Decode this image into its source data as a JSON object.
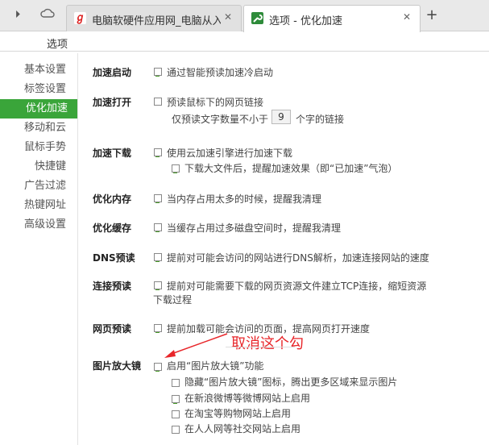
{
  "tabs": [
    {
      "title": "电脑软硬件应用网_电脑从入门",
      "icon": "site-logo-icon",
      "active": false
    },
    {
      "title": "选项 - 优化加速",
      "icon": "wrench-icon",
      "active": true
    }
  ],
  "page_title": "选项",
  "sidebar": {
    "items": [
      {
        "label": "基本设置"
      },
      {
        "label": "标签设置"
      },
      {
        "label": "优化加速",
        "active": true
      },
      {
        "label": "移动和云"
      },
      {
        "label": "鼠标手势"
      },
      {
        "label": "快捷键"
      },
      {
        "label": "广告过滤"
      },
      {
        "label": "热键网址"
      },
      {
        "label": "高级设置"
      }
    ]
  },
  "sections": {
    "startup": {
      "label": "加速启动",
      "option": "通过智能预读加速冷启动"
    },
    "open": {
      "label": "加速打开",
      "option1": "预读鼠标下的网页链接",
      "min_prefix": "仅预读文字数量不小于",
      "min_value": "9",
      "min_suffix": "个字的链接"
    },
    "download": {
      "label": "加速下载",
      "option1": "使用云加速引擎进行加速下载",
      "option2": "下载大文件后，提醒加速效果（即“已加速”气泡）"
    },
    "memory": {
      "label": "优化内存",
      "option": "当内存占用太多的时候，提醒我清理"
    },
    "cache": {
      "label": "优化缓存",
      "option": "当缓存占用过多磁盘空间时，提醒我清理"
    },
    "dns": {
      "label": "DNS预读",
      "option": "提前对可能会访问的网站进行DNS解析，加速连接网站的速度"
    },
    "preconnect": {
      "label": "连接预读",
      "option_line1": "提前对可能需要下载的网页资源文件建立TCP连接，缩短资源",
      "option_line2": "下载过程"
    },
    "prefetch": {
      "label": "网页预读",
      "option": "提前加载可能会访问的页面，提高网页打开速度"
    },
    "magnifier": {
      "label": "图片放大镜",
      "option": "启用“图片放大镜”功能",
      "sub": [
        "隐藏“图片放大镜”图标，腾出更多区域来显示图片",
        "在新浪微博等微博网站上启用",
        "在淘宝等购物网站上启用",
        "在人人网等社交网站上启用"
      ]
    }
  },
  "annotation": "取消这个勾",
  "colors": {
    "accent": "#3aa53a",
    "annotation": "#e8262a"
  }
}
